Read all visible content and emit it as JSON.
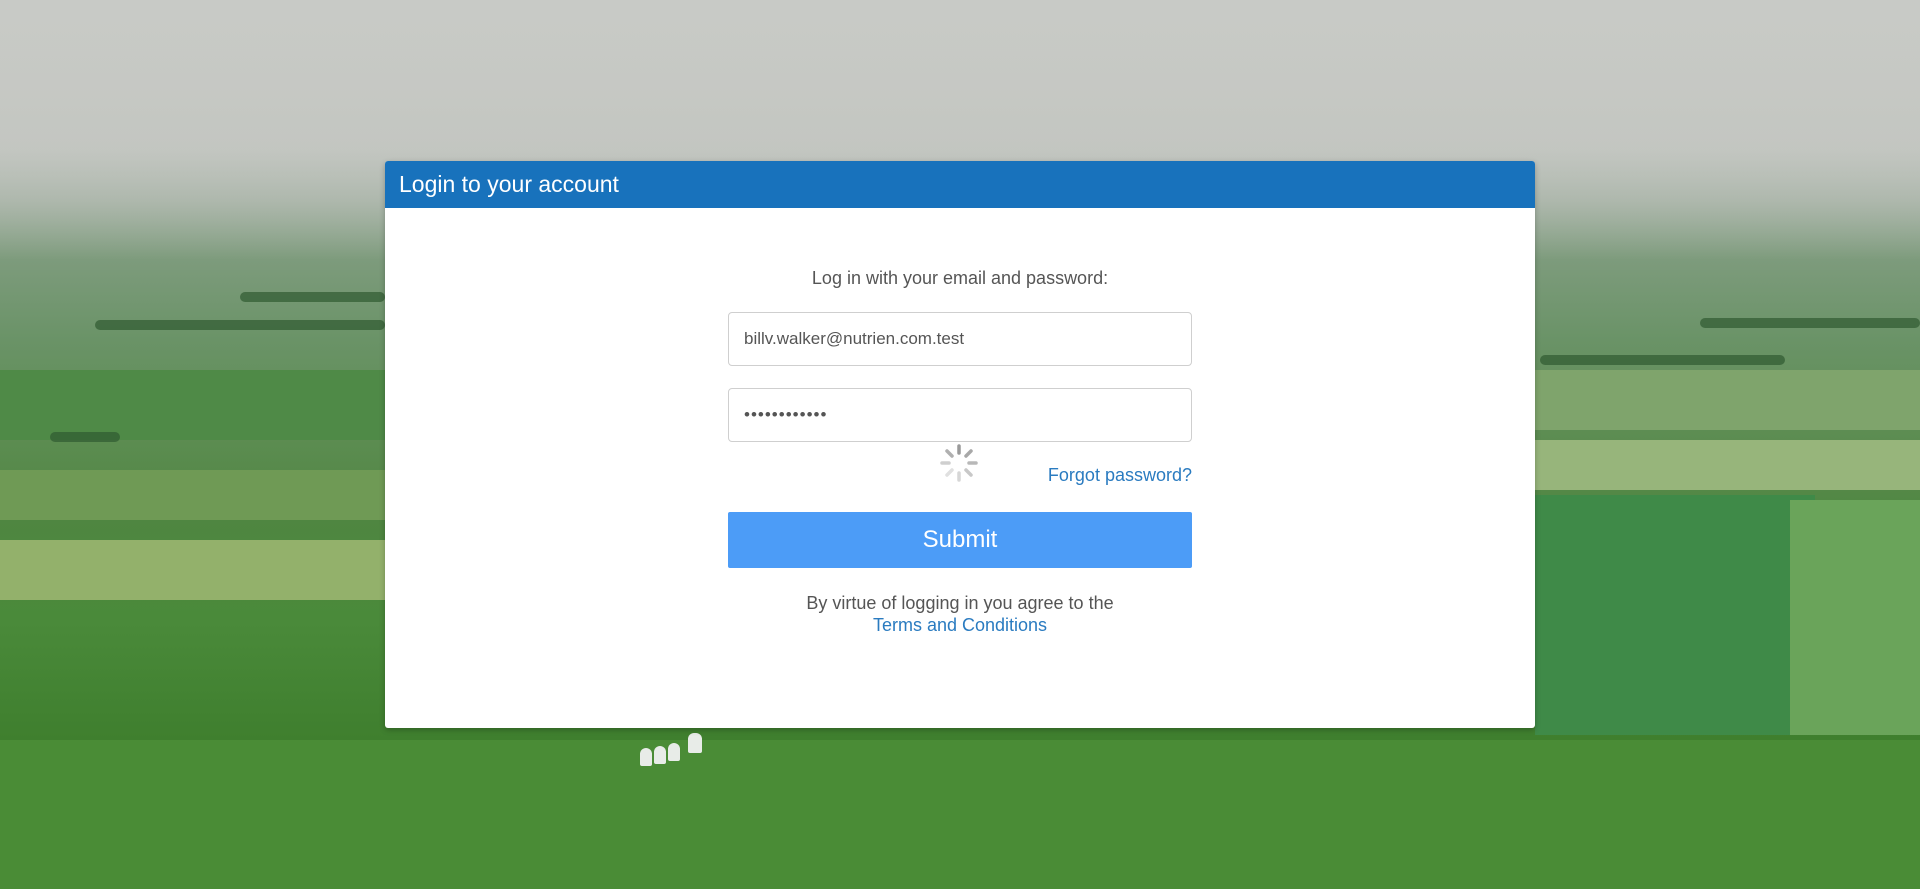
{
  "dialog": {
    "title": "Login to your account"
  },
  "form": {
    "prompt": "Log in with your email and password:",
    "email_value": "billv.walker@nutrien.com.test",
    "password_value": "••••••••••••",
    "forgot_label": "Forgot password?",
    "submit_label": "Submit",
    "terms_text": "By virtue of logging in you agree to the",
    "terms_link": "Terms and Conditions"
  },
  "icons": {
    "spinner": "loading-spinner-icon"
  },
  "colors": {
    "header": "#1872bc",
    "submit": "#4c9cf7",
    "link": "#2a7bc0"
  }
}
